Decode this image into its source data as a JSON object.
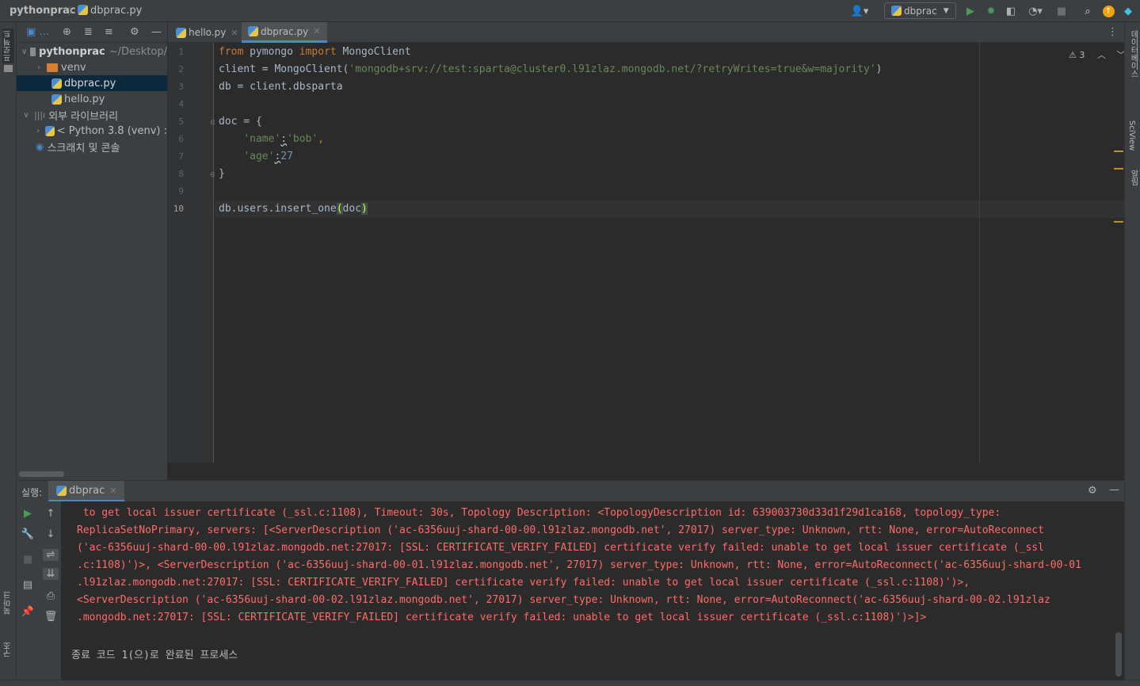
{
  "breadcrumb": {
    "project": "pythonprac",
    "file": "dbprac.py"
  },
  "toolbar": {
    "run_config": "dbprac"
  },
  "project_panel": {
    "tree": [
      {
        "label": "pythonprac",
        "extra": "~/Desktop/",
        "level": 0,
        "expanded": true,
        "type": "folder"
      },
      {
        "label": "venv",
        "level": 1,
        "expanded": false,
        "type": "folder-orange"
      },
      {
        "label": "dbprac.py",
        "level": 2,
        "type": "python",
        "selected": true
      },
      {
        "label": "hello.py",
        "level": 2,
        "type": "python"
      },
      {
        "label": "외부 라이브러리",
        "level": 0,
        "expanded": true,
        "type": "library"
      },
      {
        "label": "< Python 3.8 (venv) :",
        "level": 1,
        "expanded": false,
        "type": "python"
      },
      {
        "label": "스크래치 및 콘솔",
        "level": 0,
        "type": "scratch"
      }
    ]
  },
  "editor": {
    "tabs": [
      {
        "label": "hello.py",
        "active": false
      },
      {
        "label": "dbprac.py",
        "active": true
      }
    ],
    "warnings_count": "3",
    "current_line": 10,
    "line_numbers": [
      "1",
      "2",
      "3",
      "4",
      "5",
      "6",
      "7",
      "8",
      "9",
      "10"
    ],
    "lines": [
      {
        "from_kw": "from",
        "module": " pymongo ",
        "import_kw": "import",
        "name": " MongoClient"
      },
      {
        "prefix": "client = MongoClient(",
        "string": "'mongodb+srv://test:sparta@cluster0.l91zlaz.mongodb.net/?retryWrites=true&w=majority'",
        "suffix": ")"
      },
      {
        "text": "db = client.dbsparta"
      },
      {
        "text": ""
      },
      {
        "text": "doc = {"
      },
      {
        "key": "'name'",
        "sep": ":",
        "value": "'bob'",
        "tail": ","
      },
      {
        "key": "'age'",
        "sep": ":",
        "value": "27"
      },
      {
        "text": "}"
      },
      {
        "text": ""
      },
      {
        "prefix": "db.users.insert_one",
        "open": "(",
        "arg": "doc",
        "close": ")"
      }
    ]
  },
  "run_panel": {
    "label": "실행:",
    "tab": "dbprac",
    "output_lines": [
      " to get local issuer certificate (_ssl.c:1108), Timeout: 30s, Topology Description: <TopologyDescription id: 639003730d33d1f29d1ca168, topology_type:",
      "ReplicaSetNoPrimary, servers: [<ServerDescription ('ac-6356uuj-shard-00-00.l91zlaz.mongodb.net', 27017) server_type: Unknown, rtt: None, error=AutoReconnect",
      "('ac-6356uuj-shard-00-00.l91zlaz.mongodb.net:27017: [SSL: CERTIFICATE_VERIFY_FAILED] certificate verify failed: unable to get local issuer certificate (_ssl",
      ".c:1108)')>, <ServerDescription ('ac-6356uuj-shard-00-01.l91zlaz.mongodb.net', 27017) server_type: Unknown, rtt: None, error=AutoReconnect('ac-6356uuj-shard-00-01",
      ".l91zlaz.mongodb.net:27017: [SSL: CERTIFICATE_VERIFY_FAILED] certificate verify failed: unable to get local issuer certificate (_ssl.c:1108)')>,",
      "<ServerDescription ('ac-6356uuj-shard-00-02.l91zlaz.mongodb.net', 27017) server_type: Unknown, rtt: None, error=AutoReconnect('ac-6356uuj-shard-00-02.l91zlaz",
      ".mongodb.net:27017: [SSL: CERTIFICATE_VERIFY_FAILED] certificate verify failed: unable to get local issuer certificate (_ssl.c:1108)')>]>"
    ],
    "exit_message": "종료 코드 1(으)로 완료된 프로세스"
  },
  "side_labels": {
    "left_project": "프로젝트",
    "left_bookmarks": "북마크",
    "left_structure": "구조",
    "right_database": "데이터베이스",
    "right_sciview": "SciView",
    "right_notifications": "알림"
  },
  "colors": {
    "accent": "#4a88c7",
    "run_green": "#499c54",
    "error_red": "#ff6b68",
    "keyword": "#cc7832",
    "string": "#6a8759",
    "number": "#6897bb"
  }
}
